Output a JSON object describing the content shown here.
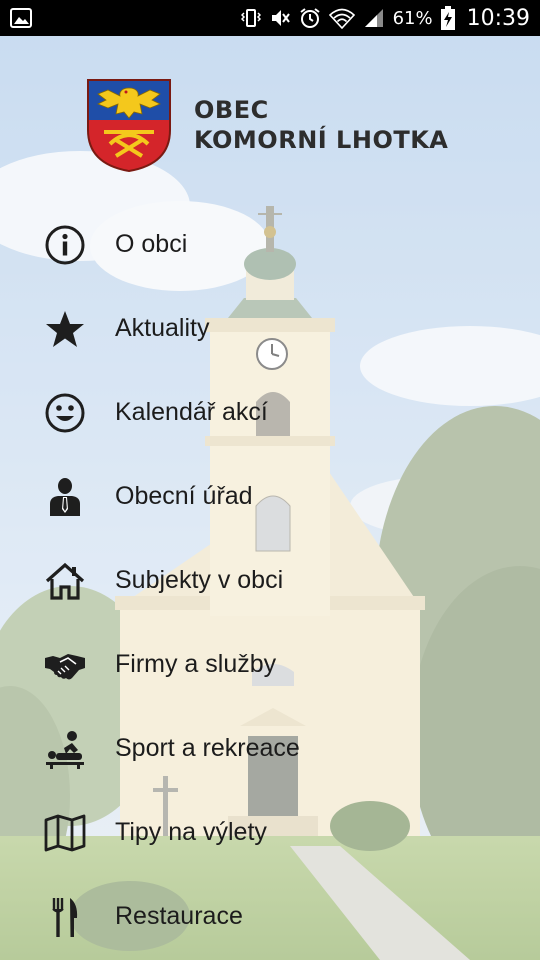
{
  "status_bar": {
    "battery_percent": "61%",
    "time": "10:39",
    "icons": [
      "image-notification-icon",
      "vibrate-icon",
      "mute-icon",
      "alarm-icon",
      "wifi-icon",
      "cell-signal-icon",
      "battery-charging-icon"
    ]
  },
  "header": {
    "title_line1": "OBEC",
    "title_line2": "KOMORNÍ LHOTKA",
    "logo_icon": "coat-of-arms-icon"
  },
  "menu": {
    "items": [
      {
        "label": "O obci",
        "icon": "info-icon"
      },
      {
        "label": "Aktuality",
        "icon": "star-icon"
      },
      {
        "label": "Kalendář akcí",
        "icon": "smiley-icon"
      },
      {
        "label": "Obecní úřad",
        "icon": "person-tie-icon"
      },
      {
        "label": "Subjekty v obci",
        "icon": "home-icon"
      },
      {
        "label": "Firmy a služby",
        "icon": "handshake-icon"
      },
      {
        "label": "Sport a rekreace",
        "icon": "massage-icon"
      },
      {
        "label": "Tipy na výlety",
        "icon": "map-icon"
      },
      {
        "label": "Restaurace",
        "icon": "cutlery-icon"
      }
    ]
  },
  "colors": {
    "icon": "#1e1e1e",
    "text": "#1c1c1c",
    "title": "#2d2d2d",
    "shield_blue": "#1f4ea8",
    "shield_red": "#d4252a",
    "eagle_yellow": "#f4c81c"
  }
}
